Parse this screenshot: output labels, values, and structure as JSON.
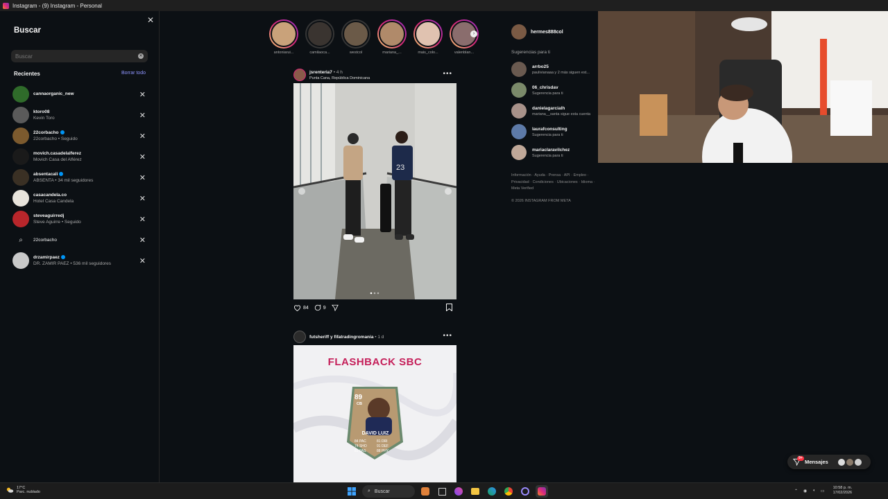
{
  "window": {
    "title": "Instagram - (9) Instagram - Personal"
  },
  "search": {
    "title": "Buscar",
    "placeholder": "Buscar",
    "recent_label": "Recientes",
    "clear_all": "Borrar todo",
    "recent": [
      {
        "name": "cannaorganic_new",
        "sub": "",
        "verified": false,
        "type": "user",
        "color": "#2f6b2a"
      },
      {
        "name": "ktoro08",
        "sub": "Kevin Toro",
        "verified": false,
        "type": "user",
        "color": "#5a5a5a"
      },
      {
        "name": "22corbacho",
        "sub": "22corbacho • Seguido",
        "verified": true,
        "type": "user",
        "color": "#7c5a2e"
      },
      {
        "name": "movich.casadelalferez",
        "sub": "Movich Casa del Alférez",
        "verified": false,
        "type": "user",
        "color": "#1a1a1a"
      },
      {
        "name": "absentacali",
        "sub": "ABSENTA • 34 mil seguidores",
        "verified": true,
        "type": "user",
        "color": "#3a3024"
      },
      {
        "name": "casacandela.co",
        "sub": "Hotel Casa Candela",
        "verified": false,
        "type": "user",
        "color": "#e8e4dc"
      },
      {
        "name": "steveaguirredj",
        "sub": "Steve Aguirre • Seguido",
        "verified": false,
        "type": "user",
        "color": "#b8262b"
      },
      {
        "name": "22corbacho",
        "sub": "",
        "verified": false,
        "type": "query",
        "color": ""
      },
      {
        "name": "drzamirpaez",
        "sub": "DR. ZAMIR PAEZ • 536 mil seguidores",
        "verified": true,
        "type": "user",
        "color": "#c9c9c9"
      }
    ]
  },
  "stories": [
    {
      "name": "antoniarui...",
      "seen": false,
      "color": "#c9a27a"
    },
    {
      "name": "camilaoca...",
      "seen": true,
      "color": "#3a3430"
    },
    {
      "name": "westcol",
      "seen": true,
      "color": "#6b5a48"
    },
    {
      "name": "mariana_...",
      "seen": false,
      "color": "#b08a6a"
    },
    {
      "name": "mais_colo...",
      "seen": false,
      "color": "#e0c2b0"
    },
    {
      "name": "valenblan...",
      "seen": false,
      "color": "#8a6d6d"
    }
  ],
  "posts": [
    {
      "user": "jsrenteria7",
      "time": "• 4 h",
      "location": "Punta Cana, República Dominicana",
      "likes": "84",
      "comments": "9"
    },
    {
      "user": "futsheriff y fifatradingromania",
      "time": "• 1 d",
      "location": "",
      "card": {
        "headline": "FLASHBACK SBC",
        "rating": "89",
        "position": "CB",
        "player": "DAVID LUIZ",
        "stats_left": [
          "84 PAC",
          "74 SHO",
          "81 PAS"
        ],
        "stats_right": [
          "81 DRI",
          "91 DEF",
          "88 PHY"
        ]
      }
    }
  ],
  "rail": {
    "me": "hermes888col",
    "suggestions_label": "Sugerencias para ti",
    "suggestions": [
      {
        "name": "arrbo25",
        "sub": "paulivianaaa y 2 más siguen est...",
        "color": "#6a5a50"
      },
      {
        "name": "06_chrisdav",
        "sub": "Sugerencia para ti",
        "color": "#7b8a6a"
      },
      {
        "name": "danielagarcialh",
        "sub": "mariana__santa sigue esta cuenta",
        "color": "#a8928a"
      },
      {
        "name": "laurafconsulting",
        "sub": "Sugerencia para ti",
        "color": "#5d7aa8"
      },
      {
        "name": "mariaclaravilchez",
        "sub": "Sugerencia para ti",
        "color": "#c0a898"
      }
    ],
    "footer_links": "Información · Ayuda · Prensa · API · Empleo · Privacidad · Condiciones · Ubicaciones · Idioma · Meta Verified",
    "copyright": "© 2026 INSTAGRAM FROM META"
  },
  "messages": {
    "label": "Mensajes",
    "badge": "9+"
  },
  "taskbar": {
    "temp": "17°C",
    "weather": "Parc. nublado",
    "search": "Buscar",
    "time": "10:58 p. m.",
    "date": "17/02/2026"
  }
}
